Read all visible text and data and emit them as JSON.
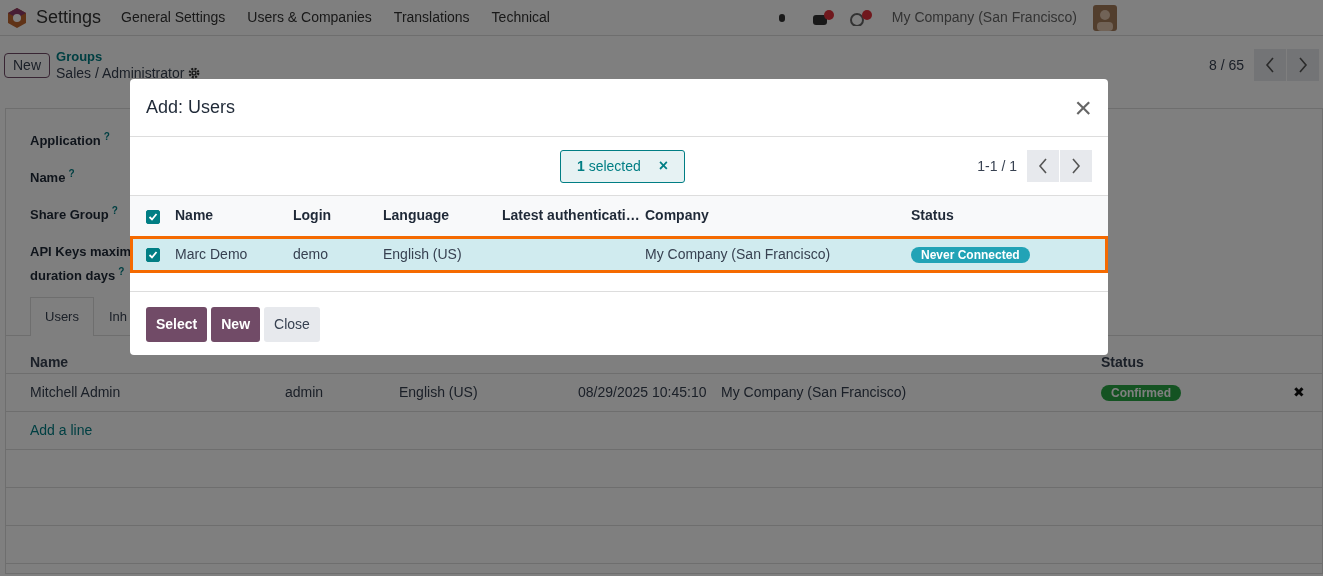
{
  "navbar": {
    "app": "Settings",
    "menu": [
      "General Settings",
      "Users & Companies",
      "Translations",
      "Technical"
    ],
    "company": "My Company (San Francisco)"
  },
  "control_panel": {
    "new_button": "New",
    "breadcrumb": "Groups",
    "record": "Sales / Administrator",
    "pager": "8 / 65"
  },
  "form": {
    "fields": [
      {
        "label": "Application",
        "help": "?"
      },
      {
        "label": "Name",
        "help": "?"
      },
      {
        "label": "Share Group",
        "help": "?"
      },
      {
        "label": "API Keys maxim",
        "label_2": "duration days",
        "help": "?"
      }
    ],
    "tabs": [
      {
        "label": "Users",
        "selected": true
      },
      {
        "label": "Inh",
        "selected": false
      }
    ],
    "table": {
      "columns": [
        {
          "label": "Name"
        },
        {
          "label": "Status"
        }
      ],
      "rows": [
        {
          "cells": [
            "Mitchell Admin",
            "admin",
            "English (US)",
            "08/29/2025 10:45:10",
            "My Company (San Francisco)"
          ],
          "status": {
            "label": "Confirmed",
            "kind": "success"
          },
          "remove": "✖"
        }
      ],
      "add_line": "Add a line"
    }
  },
  "dialog": {
    "title": "Add: Users",
    "close": "×",
    "selection": "**1** selected",
    "selection_clear": "×",
    "pager": "1-1 / 1",
    "table": {
      "all_checked": true,
      "columns": [
        "Name",
        "Login",
        "Language",
        "Latest authenticati…",
        "Company",
        "Status"
      ],
      "rows": [
        {
          "checked": true,
          "selected": true,
          "highlighted": true,
          "cells": [
            "Marc Demo",
            "demo",
            "English (US)",
            "",
            "My Company (San Francisco)"
          ],
          "status": {
            "label": "Never Connected",
            "kind": "info"
          }
        }
      ]
    },
    "buttons": [
      {
        "label": "Select",
        "kind": "primary"
      },
      {
        "label": "New",
        "kind": "primary"
      },
      {
        "label": "Close",
        "kind": "secondary"
      }
    ]
  }
}
